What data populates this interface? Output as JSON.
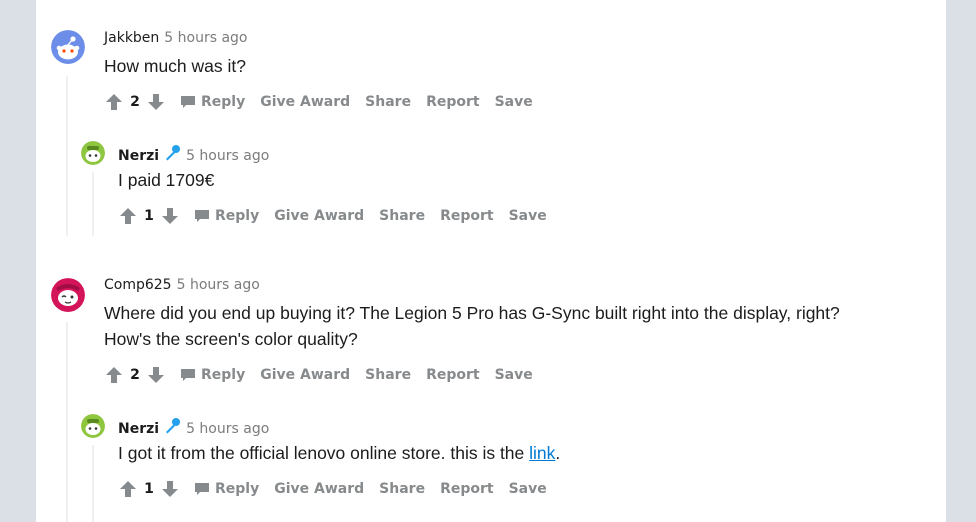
{
  "colors": {
    "background": "#dae0e6",
    "panel": "#ffffff",
    "action_gray": "#878a8c",
    "link": "#0079d3",
    "thread_line": "#edeff1"
  },
  "actions": {
    "reply": "Reply",
    "give_award": "Give Award",
    "share": "Share",
    "report": "Report",
    "save": "Save"
  },
  "comments": [
    {
      "author": "Jakkben",
      "time": "5 hours ago",
      "text": "How much was it?",
      "score": "2",
      "avatar_icon": "snoo-blue-avatar-icon"
    },
    {
      "author": "Nerzi",
      "time": "5 hours ago",
      "text": "I paid 1709€",
      "score": "1",
      "op_badge_icon": "microphone-icon",
      "avatar_icon": "snoo-green-avatar-icon"
    },
    {
      "author": "Comp625",
      "time": "5 hours ago",
      "text_line1": "Where did you end up buying it? The Legion 5 Pro has G-Sync built right into the display, right?",
      "text_line2": "How's the screen's color quality?",
      "score": "2",
      "avatar_icon": "snoo-pink-avatar-icon"
    },
    {
      "author": "Nerzi",
      "time": "5 hours ago",
      "text_before_link": "I got it from the official lenovo online store. this is the ",
      "link_text": "link",
      "text_after_link": ".",
      "score": "1",
      "op_badge_icon": "microphone-icon",
      "avatar_icon": "snoo-green-avatar-icon"
    }
  ]
}
